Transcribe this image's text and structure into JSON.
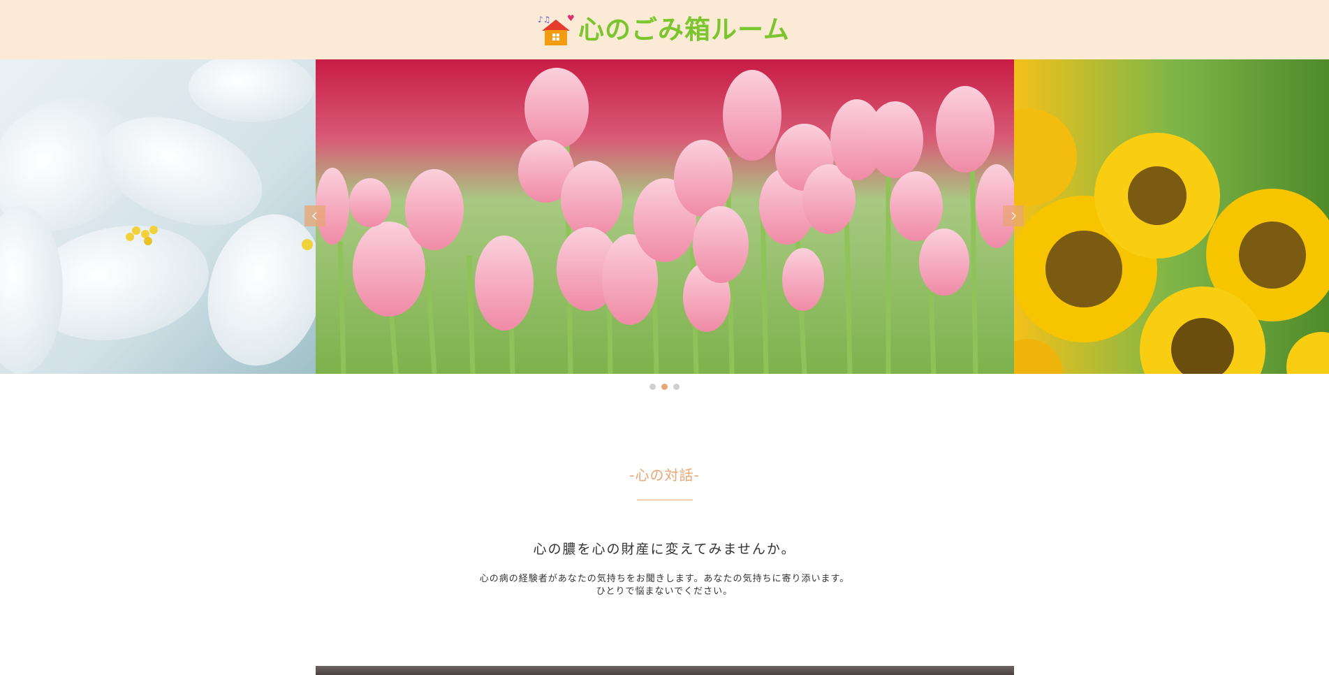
{
  "header": {
    "logo_text": "心のごみ箱ルーム",
    "brand_color": "#7bc52e",
    "background": "#fbead5"
  },
  "slider": {
    "slides": [
      {
        "name": "white-lily",
        "colors": [
          "#dfe9ef",
          "#ffffff",
          "#f2d23a"
        ]
      },
      {
        "name": "pink-tulips",
        "colors": [
          "#f6b1c4",
          "#c81c45",
          "#8fbf5a"
        ]
      },
      {
        "name": "sunflowers",
        "colors": [
          "#f7c400",
          "#7b5a12",
          "#4f8a2a"
        ]
      }
    ],
    "active_index": 1,
    "prev_icon": "chevron-left-icon",
    "next_icon": "chevron-right-icon",
    "accent": "#e9a673"
  },
  "section": {
    "title": "-心の対話-",
    "headline": "心の膿を心の財産に変えてみませんか。",
    "body_line1": "心の病の経験者があなたの気持ちをお聞きします。あなたの気持ちに寄り添います。",
    "body_line2": "ひとりで悩まないでください。"
  }
}
